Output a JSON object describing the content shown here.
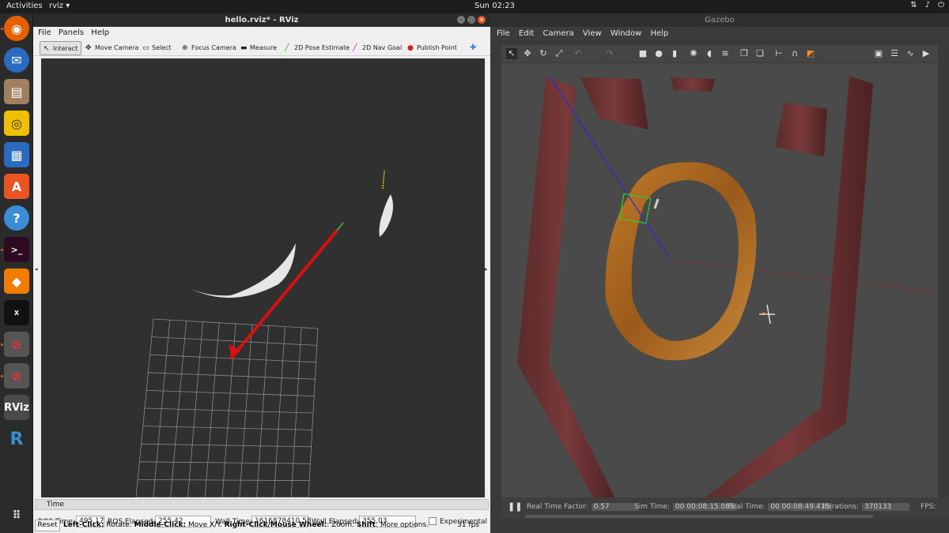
{
  "topbar": {
    "activities": "Activities",
    "app_name": "rviz ▾",
    "clock": "Sun 02:23"
  },
  "dock": {
    "items": [
      "firefox",
      "thunderbird",
      "files",
      "rhythmbox",
      "libreoffice-writer",
      "software-center",
      "help",
      "terminal",
      "layers",
      "xterm",
      "gazebo-1",
      "gazebo-2",
      "rviz",
      "r"
    ]
  },
  "rviz": {
    "title": "hello.rviz* - RViz",
    "menu": [
      "File",
      "Panels",
      "Help"
    ],
    "tools": [
      {
        "label": "Interact",
        "icon": "interact-icon"
      },
      {
        "label": "Move Camera",
        "icon": "move-camera-icon"
      },
      {
        "label": "Select",
        "icon": "select-icon"
      },
      {
        "label": "Focus Camera",
        "icon": "focus-camera-icon"
      },
      {
        "label": "Measure",
        "icon": "measure-icon"
      },
      {
        "label": "2D Pose Estimate",
        "icon": "pose-estimate-icon"
      },
      {
        "label": "2D Nav Goal",
        "icon": "nav-goal-icon"
      },
      {
        "label": "Publish Point",
        "icon": "publish-point-icon"
      }
    ],
    "time_panel": {
      "header": "Time",
      "ros_time_label": "ROS Time:",
      "ros_time": "495.17",
      "ros_elapsed_label": "ROS Elapsed:",
      "ros_elapsed": "255.42",
      "wall_time_label": "Wall Time:",
      "wall_time": "1616878410.58",
      "wall_elapsed_label": "Wall Elapsed:",
      "wall_elapsed": "355.03",
      "experimental_label": "Experimental"
    },
    "status": {
      "reset": "Reset",
      "hint_1b": "Left-Click:",
      "hint_1": " Rotate. ",
      "hint_2b": "Middle-Click:",
      "hint_2": " Move X/Y. ",
      "hint_3b": "Right-Click/Mouse Wheel:",
      "hint_3": ": Zoom. ",
      "hint_4b": "Shift",
      "hint_4": ": More options.",
      "fps": "31 fps"
    }
  },
  "gazebo": {
    "title": "Gazebo",
    "menu": [
      "File",
      "Edit",
      "Camera",
      "View",
      "Window",
      "Help"
    ],
    "status": {
      "real_time_factor_label": "Real Time Factor:",
      "real_time_factor": "0.57",
      "sim_time_label": "Sim Time:",
      "sim_time": "00 00:08:15.085",
      "real_time_label": "Real Time:",
      "real_time": "00 00:08:49.415",
      "iterations_label": "Iterations:",
      "iterations": "370133",
      "fps_label": "FPS:"
    }
  }
}
